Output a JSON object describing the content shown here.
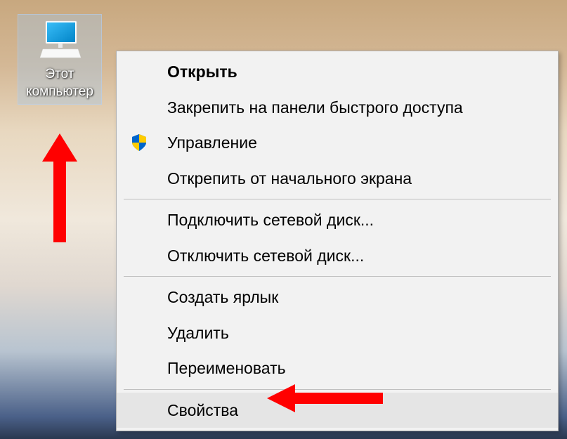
{
  "desktop": {
    "icon_label": "Этот компьютер"
  },
  "context_menu": {
    "items": [
      {
        "label": "Открыть",
        "bold": true,
        "icon": null
      },
      {
        "label": "Закрепить на панели быстрого доступа",
        "bold": false,
        "icon": null
      },
      {
        "label": "Управление",
        "bold": false,
        "icon": "shield"
      },
      {
        "label": "Открепить от начального экрана",
        "bold": false,
        "icon": null
      }
    ],
    "items2": [
      {
        "label": "Подключить сетевой диск...",
        "bold": false,
        "icon": null
      },
      {
        "label": "Отключить сетевой диск...",
        "bold": false,
        "icon": null
      }
    ],
    "items3": [
      {
        "label": "Создать ярлык",
        "bold": false,
        "icon": null
      },
      {
        "label": "Удалить",
        "bold": false,
        "icon": null
      },
      {
        "label": "Переименовать",
        "bold": false,
        "icon": null
      }
    ],
    "items4": [
      {
        "label": "Свойства",
        "bold": false,
        "icon": null,
        "highlighted": true
      }
    ]
  },
  "annotations": {
    "arrow_color": "#ff0000"
  }
}
